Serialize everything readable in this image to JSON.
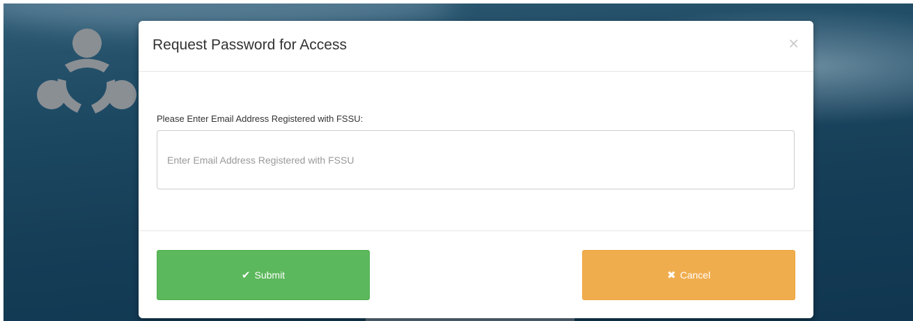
{
  "modal": {
    "title": "Request Password for Access",
    "close_glyph": "×",
    "field_label": "Please Enter Email Address Registered with FSSU:",
    "email_placeholder": "Enter Email Address Registered with FSSU",
    "email_value": ""
  },
  "footer": {
    "submit_icon": "✔",
    "submit_label": "Submit",
    "cancel_icon": "✖",
    "cancel_label": "Cancel"
  },
  "icons": {
    "logo": "people-circle-logo",
    "close": "close-icon",
    "submit": "check-icon",
    "cancel": "x-icon"
  },
  "colors": {
    "submit": "#5cb85c",
    "cancel": "#f0ad4e",
    "background": "#163e57"
  }
}
